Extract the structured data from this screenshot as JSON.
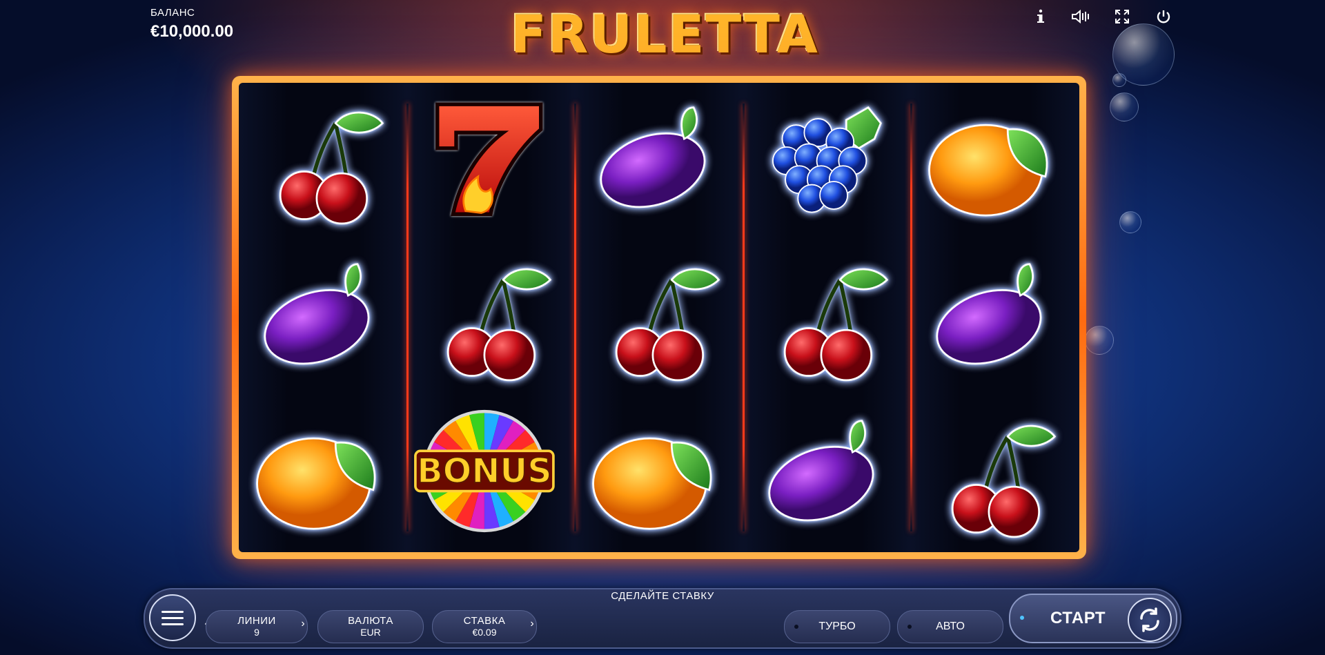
{
  "balance": {
    "label": "БАЛАНС",
    "value": "€10,000.00"
  },
  "logo": {
    "text": "FRULETTA"
  },
  "top_icons": [
    "info-icon",
    "sound-icon",
    "fullscreen-icon",
    "power-icon"
  ],
  "reels": [
    [
      "cherry",
      "plum",
      "orange"
    ],
    [
      "seven",
      "cherry",
      "bonus"
    ],
    [
      "plum",
      "cherry",
      "orange"
    ],
    [
      "grapes",
      "cherry",
      "plum"
    ],
    [
      "orange",
      "plum",
      "cherry"
    ]
  ],
  "bonus_text": "BONUS",
  "bottom_bar": {
    "title": "СДЕЛАЙТЕ СТАВКУ",
    "lines": {
      "label": "ЛИНИИ",
      "value": "9"
    },
    "currency": {
      "label": "ВАЛЮТА",
      "value": "EUR"
    },
    "bet": {
      "label": "СТАВКА",
      "value": "€0.09"
    },
    "turbo": "ТУРБО",
    "auto": "АВТО",
    "start": "СТАРТ"
  },
  "colors": {
    "frame": "#ff8a1e",
    "reel_bg": "#03050f",
    "bar_bg": "#1f2a4e"
  }
}
